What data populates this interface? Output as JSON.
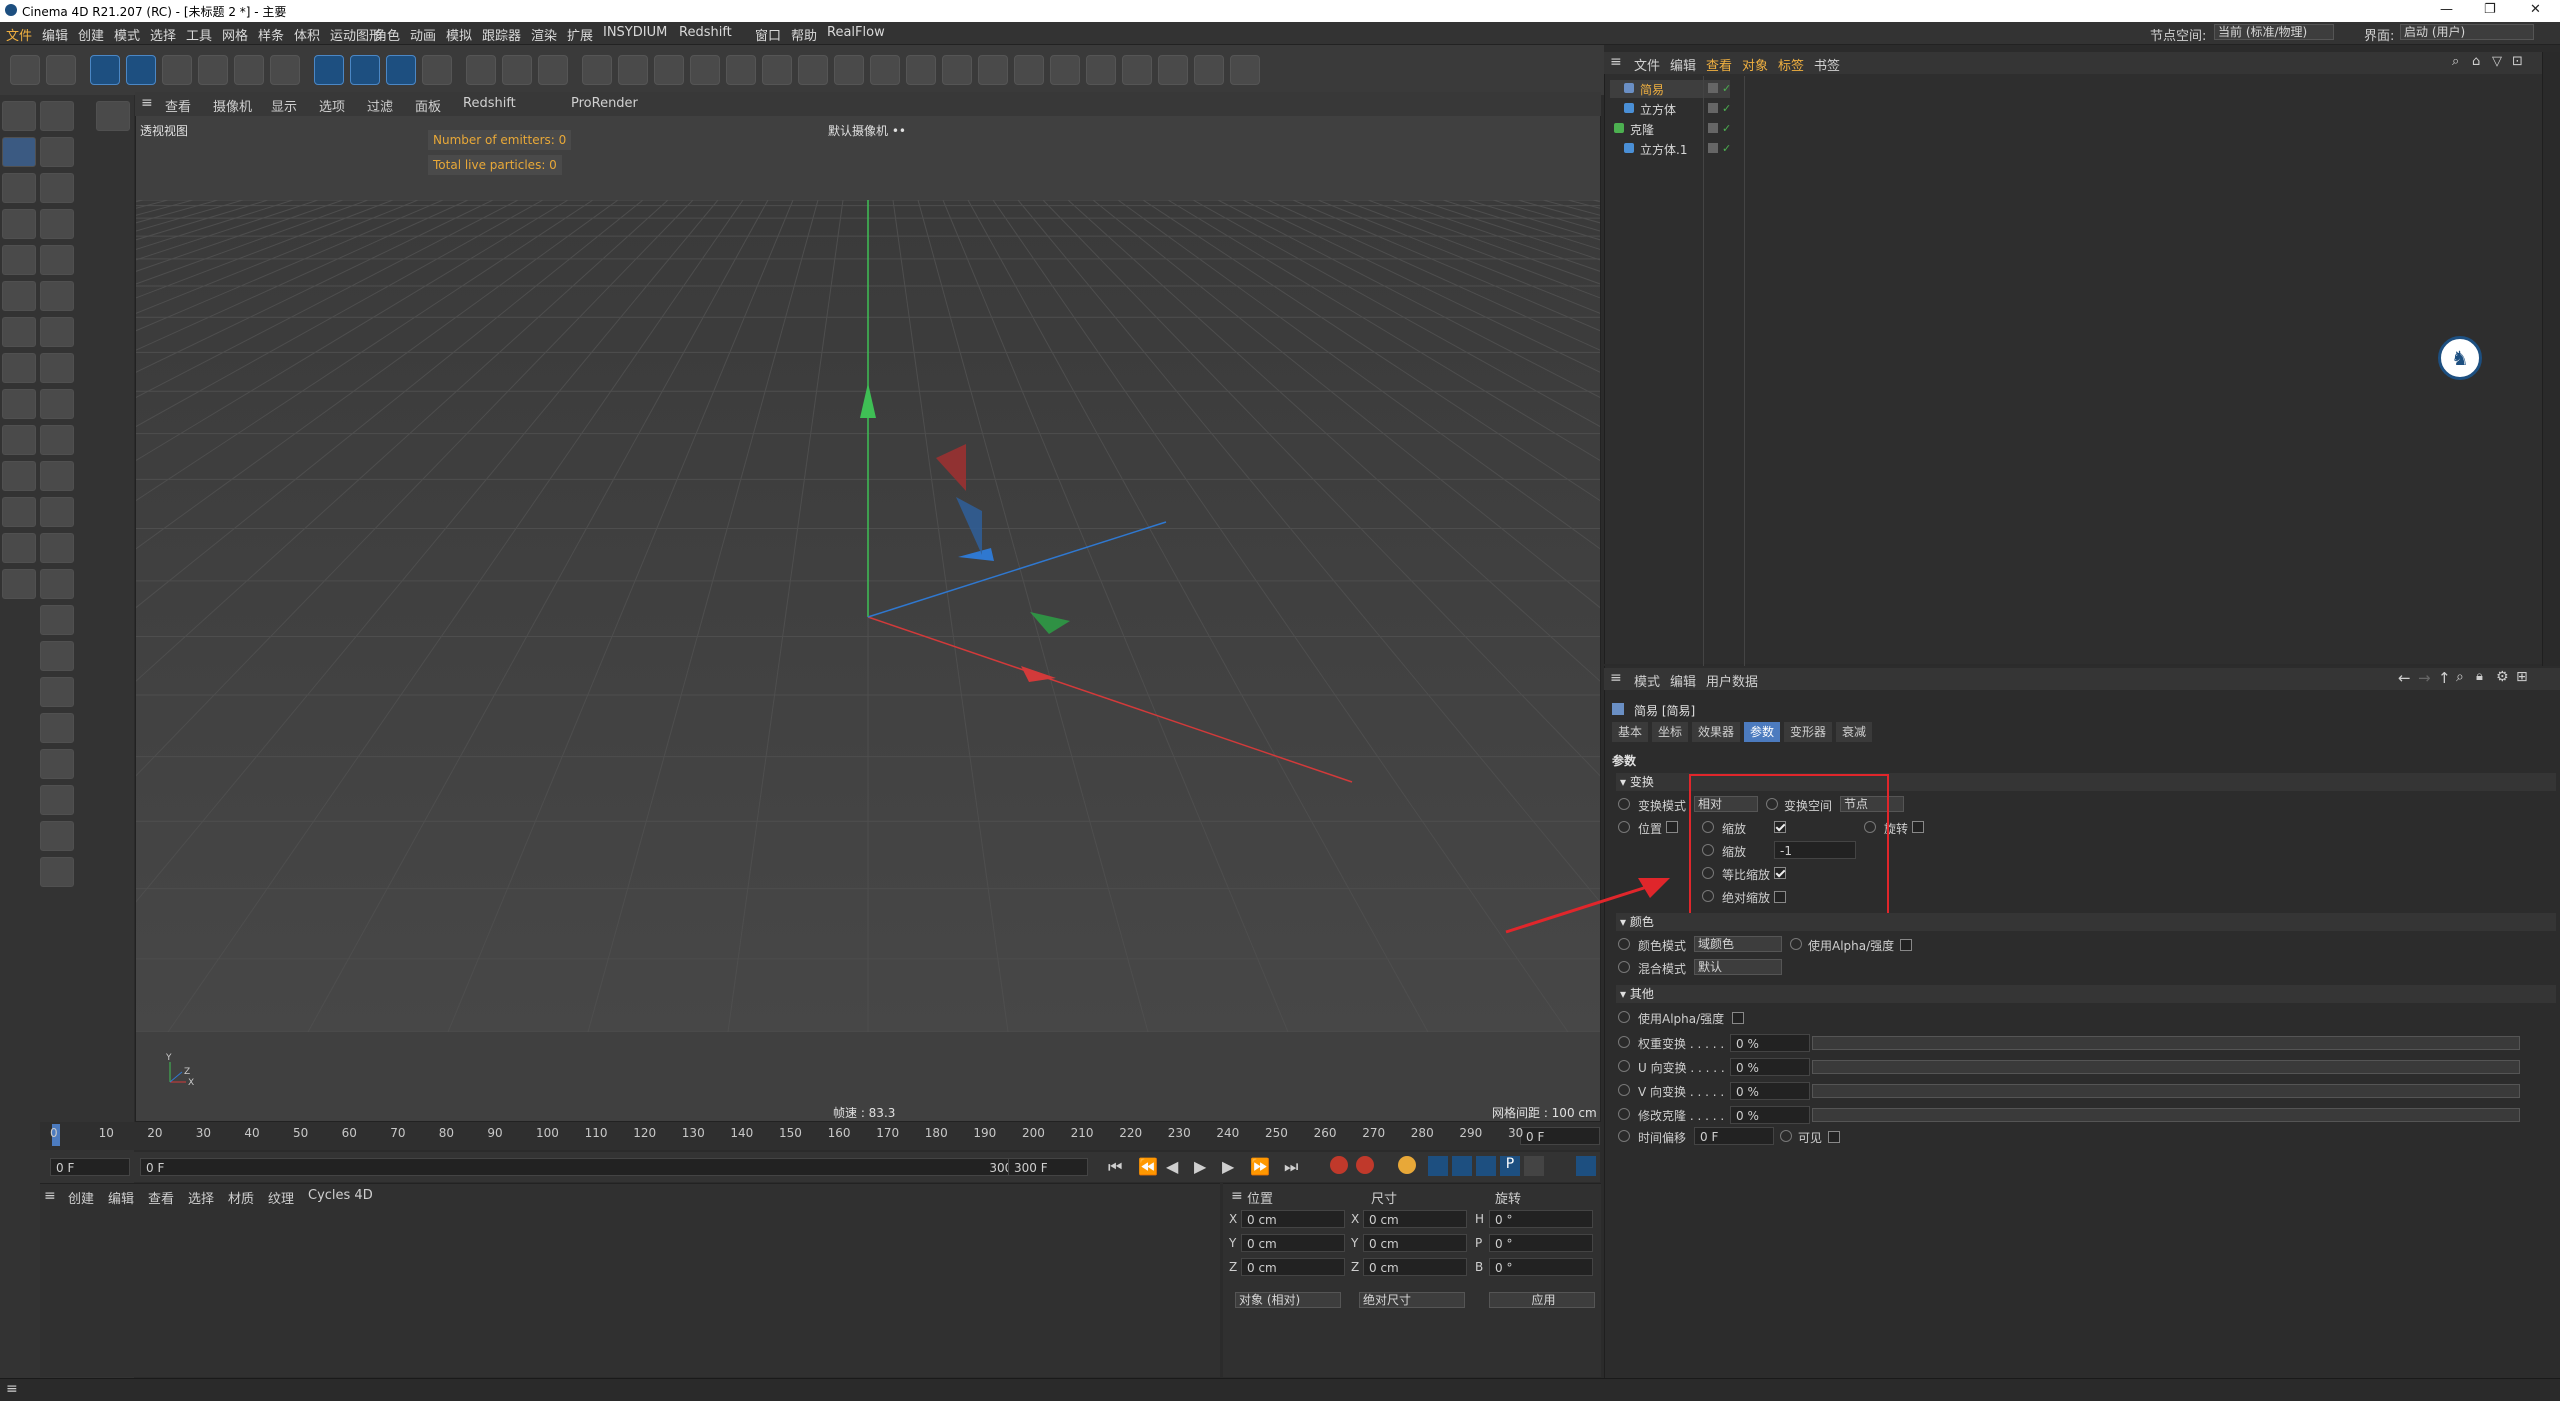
{
  "window": {
    "title": "Cinema 4D R21.207 (RC) - [未标题 2 *] - 主要",
    "node_space_label": "节点空间:",
    "node_space_value": "当前 (标准/物理)",
    "layout_label": "界面:",
    "layout_value": "启动 (用户)"
  },
  "menubar": [
    "文件",
    "编辑",
    "创建",
    "模式",
    "选择",
    "工具",
    "网格",
    "样条",
    "体积",
    "运动图形",
    "角色",
    "动画",
    "模拟",
    "跟踪器",
    "渲染",
    "扩展",
    "INSYDIUM",
    "Redshift",
    "窗口",
    "帮助",
    "RealFlow"
  ],
  "viewport": {
    "menu": [
      "查看",
      "摄像机",
      "显示",
      "选项",
      "过滤",
      "面板",
      "Redshift",
      "ProRender"
    ],
    "label": "透视视图",
    "camera": "默认摄像机 ••",
    "hud_emitters": "Number of emitters: 0",
    "hud_particles": "Total live particles: 0",
    "fps": "帧速 : 83.3",
    "grid": "网格间距 : 100 cm"
  },
  "timeline": {
    "ticks": [
      "0",
      "10",
      "20",
      "30",
      "40",
      "50",
      "60",
      "70",
      "80",
      "90",
      "100",
      "110",
      "120",
      "130",
      "140",
      "150",
      "160",
      "170",
      "180",
      "190",
      "200",
      "210",
      "220",
      "230",
      "240",
      "250",
      "260",
      "270",
      "280",
      "290",
      "30"
    ],
    "current": "0 F",
    "start": "0 F",
    "range_start": "0 F",
    "range_end": "300 F",
    "end": "300 F"
  },
  "materials": {
    "menu": [
      "创建",
      "编辑",
      "查看",
      "选择",
      "材质",
      "纹理",
      "Cycles 4D"
    ]
  },
  "coords": {
    "headers": [
      "位置",
      "尺寸",
      "旋转"
    ],
    "rows": [
      {
        "a": "X",
        "p": "0 cm",
        "b": "X",
        "s": "0 cm",
        "c": "H",
        "r": "0 °"
      },
      {
        "a": "Y",
        "p": "0 cm",
        "b": "Y",
        "s": "0 cm",
        "c": "P",
        "r": "0 °"
      },
      {
        "a": "Z",
        "p": "0 cm",
        "b": "Z",
        "s": "0 cm",
        "c": "B",
        "r": "0 °"
      }
    ],
    "mode": "对象 (相对)",
    "size_mode": "绝对尺寸",
    "apply": "应用"
  },
  "object_manager": {
    "menu": [
      "文件",
      "编辑",
      "查看",
      "对象",
      "标签",
      "书签"
    ],
    "objects": [
      {
        "name": "简易",
        "indent": 1
      },
      {
        "name": "立方体",
        "indent": 1
      },
      {
        "name": "克隆",
        "indent": 0
      },
      {
        "name": "立方体.1",
        "indent": 1
      }
    ]
  },
  "attributes": {
    "menu": [
      "模式",
      "编辑",
      "用户数据"
    ],
    "object_title": "简易 [简易]",
    "tabs": [
      "基本",
      "坐标",
      "效果器",
      "参数",
      "变形器",
      "衰减"
    ],
    "active_tab": "参数",
    "section_title": "参数",
    "transform": {
      "title": "变换",
      "mode_label": "变换模式",
      "mode_value": "相对",
      "space_label": "变换空间",
      "space_value": "节点",
      "position": "位置",
      "scale": "缩放",
      "rotate": "旋转",
      "scale2": "缩放",
      "scale_value": "-1",
      "uniform": "等比缩放",
      "absolute": "绝对缩放"
    },
    "color": {
      "title": "颜色",
      "mode_label": "颜色模式",
      "mode_value": "域颜色",
      "use_alpha": "使用Alpha/强度",
      "blend_label": "混合模式",
      "blend_value": "默认"
    },
    "other": {
      "title": "其他",
      "use_alpha": "使用Alpha/强度",
      "weight": "权重变换 . . . . .",
      "weight_v": "0 %",
      "u": "U 向变换 . . . . .",
      "u_v": "0 %",
      "v": "V 向变换 . . . . .",
      "v_v": "0 %",
      "clone": "修改克隆 . . . . .",
      "clone_v": "0 %",
      "time": "时间偏移",
      "time_v": "0 F",
      "visible": "可见"
    }
  },
  "colors": {
    "accent": "#4c7bbf",
    "highlight": "#e0262b",
    "hud": "#e8a838"
  }
}
